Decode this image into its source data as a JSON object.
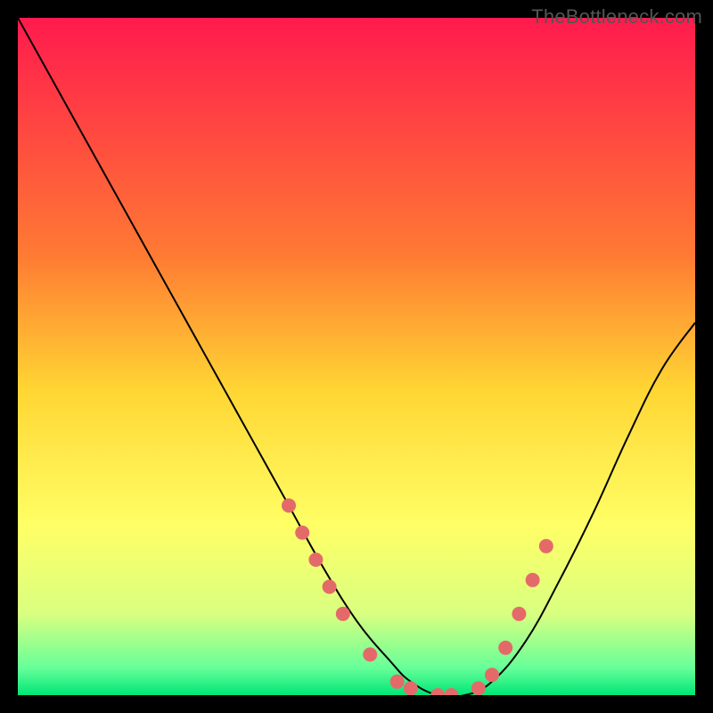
{
  "watermark": "TheBottleneck.com",
  "chart_data": {
    "type": "line",
    "title": "",
    "xlabel": "",
    "ylabel": "",
    "xlim": [
      0,
      100
    ],
    "ylim": [
      0,
      100
    ],
    "background_gradient": {
      "stops": [
        {
          "pos": 0.0,
          "color": "#ff1a4d"
        },
        {
          "pos": 0.35,
          "color": "#ff7a33"
        },
        {
          "pos": 0.55,
          "color": "#ffd633"
        },
        {
          "pos": 0.75,
          "color": "#ffff66"
        },
        {
          "pos": 0.88,
          "color": "#d9ff80"
        },
        {
          "pos": 0.96,
          "color": "#66ff99"
        },
        {
          "pos": 1.0,
          "color": "#00e676"
        }
      ]
    },
    "series": [
      {
        "name": "bottleneck-curve",
        "color": "#000000",
        "x": [
          0,
          5,
          10,
          15,
          20,
          25,
          30,
          35,
          40,
          45,
          50,
          55,
          58,
          62,
          66,
          70,
          75,
          80,
          85,
          90,
          95,
          100
        ],
        "y": [
          100,
          91,
          82,
          73,
          64,
          55,
          46,
          37,
          28,
          19,
          11,
          5,
          2,
          0,
          0,
          2,
          8,
          17,
          27,
          38,
          48,
          55
        ]
      }
    ],
    "marker_group": {
      "name": "highlight-dots",
      "color": "#e46a6a",
      "radius": 8,
      "points": [
        {
          "x": 40,
          "y": 28
        },
        {
          "x": 42,
          "y": 24
        },
        {
          "x": 44,
          "y": 20
        },
        {
          "x": 46,
          "y": 16
        },
        {
          "x": 48,
          "y": 12
        },
        {
          "x": 52,
          "y": 6
        },
        {
          "x": 56,
          "y": 2
        },
        {
          "x": 58,
          "y": 1
        },
        {
          "x": 62,
          "y": 0
        },
        {
          "x": 64,
          "y": 0
        },
        {
          "x": 68,
          "y": 1
        },
        {
          "x": 70,
          "y": 3
        },
        {
          "x": 72,
          "y": 7
        },
        {
          "x": 74,
          "y": 12
        },
        {
          "x": 76,
          "y": 17
        },
        {
          "x": 78,
          "y": 22
        }
      ]
    }
  }
}
